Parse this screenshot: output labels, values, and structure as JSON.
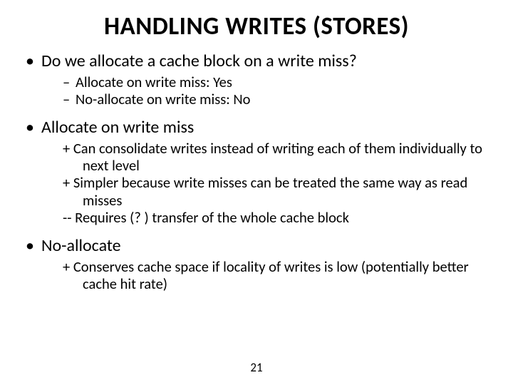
{
  "title": "HANDLING WRITES (STORES)",
  "b1": {
    "head": "Do we allocate a cache block on a write miss?",
    "s1": "Allocate on write miss: Yes",
    "s2": "No-allocate on write miss: No"
  },
  "b2": {
    "head": "Allocate on write miss",
    "s1": "+ Can consolidate writes instead of writing each of them individually to next level",
    "s2": "+ Simpler because write misses can be treated the same way as read misses",
    "s3": "-- Requires (? ) transfer of the whole cache block"
  },
  "b3": {
    "head": "No-allocate",
    "s1": "+ Conserves cache space if locality of writes is low (potentially better cache hit rate)"
  },
  "page": "21"
}
